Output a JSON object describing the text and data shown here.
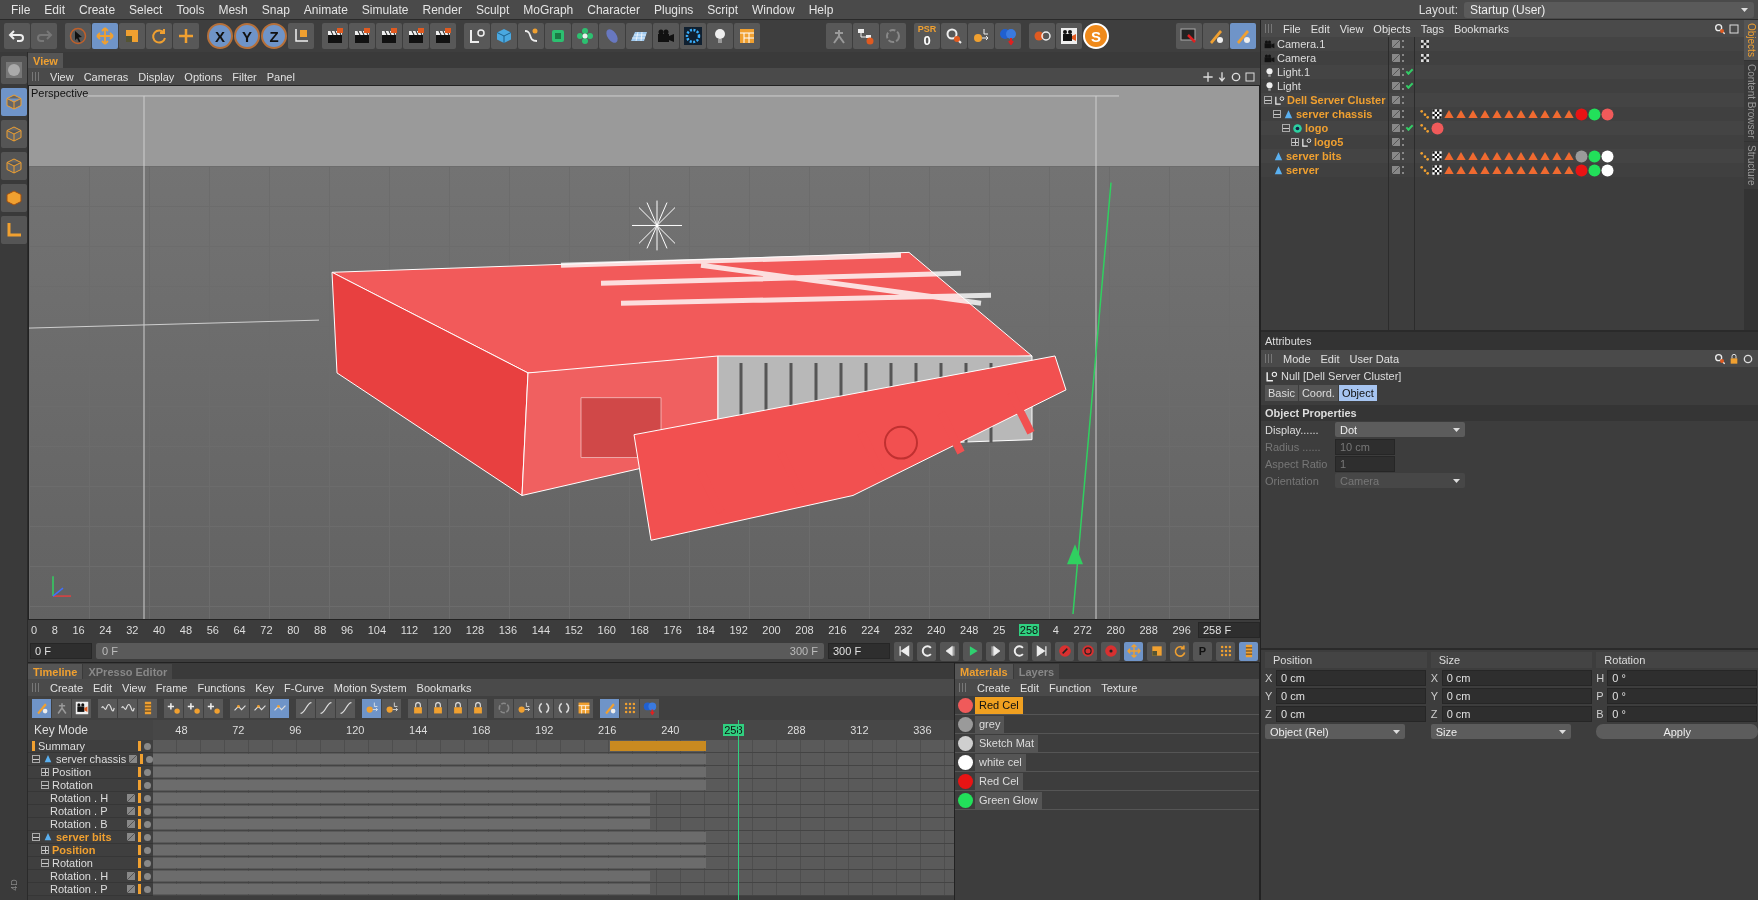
{
  "menu_bar": {
    "items": [
      "File",
      "Edit",
      "Create",
      "Select",
      "Tools",
      "Mesh",
      "Snap",
      "Animate",
      "Simulate",
      "Render",
      "Sculpt",
      "MoGraph",
      "Character",
      "Plugins",
      "Script",
      "Window",
      "Help"
    ],
    "layout_label": "Layout:",
    "layout_value": "Startup (User)"
  },
  "toolbar": {
    "left": [
      [
        {
          "kind": "undo",
          "selected": false
        },
        {
          "kind": "redo",
          "selected": false
        }
      ],
      [
        {
          "kind": "cursor",
          "selected": false
        },
        {
          "kind": "move",
          "selected": true
        },
        {
          "kind": "scale",
          "selected": false
        },
        {
          "kind": "rotate",
          "selected": false
        },
        {
          "kind": "plus",
          "selected": false
        }
      ],
      [
        {
          "kind": "axis",
          "label": "X",
          "selected": true
        },
        {
          "kind": "axis",
          "label": "Y",
          "selected": true
        },
        {
          "kind": "axis",
          "label": "Z",
          "selected": true
        },
        {
          "kind": "coords",
          "selected": false
        }
      ],
      [
        {
          "kind": "clapper",
          "selected": false
        },
        {
          "kind": "clapper",
          "selected": false
        },
        {
          "kind": "clapper",
          "selected": false
        },
        {
          "kind": "clapper",
          "selected": false
        },
        {
          "kind": "clapper",
          "selected": false
        }
      ],
      [
        {
          "kind": "null",
          "selected": false
        },
        {
          "kind": "cube",
          "selected": false
        },
        {
          "kind": "pen",
          "selected": false
        },
        {
          "kind": "nurbs",
          "selected": false
        },
        {
          "kind": "cloner",
          "selected": false
        },
        {
          "kind": "deformer",
          "selected": false
        },
        {
          "kind": "floor",
          "selected": false
        },
        {
          "kind": "camera",
          "selected": false
        },
        {
          "kind": "sky",
          "selected": false
        },
        {
          "kind": "bulb",
          "selected": false
        },
        {
          "kind": "picture",
          "selected": false
        }
      ]
    ],
    "middle": [
      [
        {
          "kind": "figure",
          "selected": false
        },
        {
          "kind": "hierarchy",
          "selected": false
        },
        {
          "kind": "recycle",
          "selected": false
        }
      ],
      [
        {
          "kind": "psr",
          "label": "PSR",
          "sub": "0",
          "selected": false
        },
        {
          "kind": "magnifier",
          "selected": false
        },
        {
          "kind": "keylink",
          "selected": false
        },
        {
          "kind": "spheres",
          "selected": false
        }
      ],
      [
        {
          "kind": "record",
          "selected": false
        },
        {
          "kind": "film",
          "selected": false
        },
        {
          "kind": "coin",
          "label": "S",
          "selected": false
        }
      ]
    ],
    "right": [
      [
        {
          "kind": "monitor",
          "selected": false
        },
        {
          "kind": "brush",
          "selected": false
        },
        {
          "kind": "brush",
          "selected": true
        }
      ]
    ]
  },
  "left_tools": {
    "items": [
      {
        "kind": "sphere",
        "selected": false
      },
      {
        "kind": "cubeframe",
        "selected": true
      },
      {
        "kind": "cubeframe",
        "selected": false
      },
      {
        "kind": "cubeframe",
        "selected": false
      },
      {
        "kind": "cubeorange",
        "selected": false
      },
      {
        "kind": "laxis",
        "selected": false
      }
    ],
    "corner_label": "4D"
  },
  "viewport": {
    "tab": "View",
    "menu": [
      "View",
      "Cameras",
      "Display",
      "Options",
      "Filter",
      "Panel"
    ],
    "camera": "Perspective"
  },
  "frame_ruler": {
    "ticks": [
      {
        "label": "0",
        "selected": false
      },
      {
        "label": "8",
        "selected": false
      },
      {
        "label": "16",
        "selected": false
      },
      {
        "label": "24",
        "selected": false
      },
      {
        "label": "32",
        "selected": false
      },
      {
        "label": "40",
        "selected": false
      },
      {
        "label": "48",
        "selected": false
      },
      {
        "label": "56",
        "selected": false
      },
      {
        "label": "64",
        "selected": false
      },
      {
        "label": "72",
        "selected": false
      },
      {
        "label": "80",
        "selected": false
      },
      {
        "label": "88",
        "selected": false
      },
      {
        "label": "96",
        "selected": false
      },
      {
        "label": "104",
        "selected": false
      },
      {
        "label": "112",
        "selected": false
      },
      {
        "label": "120",
        "selected": false
      },
      {
        "label": "128",
        "selected": false
      },
      {
        "label": "136",
        "selected": false
      },
      {
        "label": "144",
        "selected": false
      },
      {
        "label": "152",
        "selected": false
      },
      {
        "label": "160",
        "selected": false
      },
      {
        "label": "168",
        "selected": false
      },
      {
        "label": "176",
        "selected": false
      },
      {
        "label": "184",
        "selected": false
      },
      {
        "label": "192",
        "selected": false
      },
      {
        "label": "200",
        "selected": false
      },
      {
        "label": "208",
        "selected": false
      },
      {
        "label": "216",
        "selected": false
      },
      {
        "label": "224",
        "selected": false
      },
      {
        "label": "232",
        "selected": false
      },
      {
        "label": "240",
        "selected": false
      },
      {
        "label": "248",
        "selected": false
      },
      {
        "label": "25",
        "selected": false
      },
      {
        "label": "258",
        "selected": true
      },
      {
        "label": "4",
        "selected": false
      },
      {
        "label": "272",
        "selected": false
      },
      {
        "label": "280",
        "selected": false
      },
      {
        "label": "288",
        "selected": false
      },
      {
        "label": "296",
        "selected": false
      }
    ],
    "current_field": "258 F"
  },
  "frame_controls": {
    "start_field": "0 F",
    "slider_start": "0 F",
    "slider_end": "300 F",
    "level": 1,
    "end_field": "300 F",
    "transport": [
      {
        "kind": "first",
        "selected": false
      },
      {
        "kind": "loop",
        "selected": false
      },
      {
        "kind": "prevkey",
        "selected": false
      },
      {
        "kind": "play",
        "selected": false
      },
      {
        "kind": "nextkey",
        "selected": false
      },
      {
        "kind": "loop",
        "selected": false
      },
      {
        "kind": "last",
        "selected": false
      },
      {
        "kind": "recred",
        "selected": false
      },
      {
        "kind": "autokey",
        "selected": false
      },
      {
        "kind": "keyhelp",
        "selected": false
      },
      {
        "kind": "move",
        "selected": true
      },
      {
        "kind": "scale",
        "selected": false
      },
      {
        "kind": "rotate",
        "selected": false
      },
      {
        "kind": "param",
        "label": "P",
        "selected": false
      },
      {
        "kind": "dots",
        "selected": false
      },
      {
        "kind": "tlbars",
        "selected": true
      }
    ]
  },
  "timeline": {
    "tabs": [
      {
        "label": "Timeline",
        "selected": true
      },
      {
        "label": "XPresso Editor",
        "selected": false
      }
    ],
    "menu": [
      "Create",
      "Edit",
      "View",
      "Frame",
      "Functions",
      "Key",
      "F-Curve",
      "Motion System",
      "Bookmarks"
    ],
    "tools": [
      [
        {
          "kind": "brush",
          "selected": true
        },
        {
          "kind": "figure",
          "selected": false
        },
        {
          "kind": "film",
          "selected": false
        }
      ],
      [
        {
          "kind": "wave",
          "selected": false
        },
        {
          "kind": "wave",
          "selected": false
        },
        {
          "kind": "tlbars",
          "selected": false
        }
      ],
      [
        {
          "kind": "keyadd",
          "selected": false
        },
        {
          "kind": "keyadd",
          "selected": false
        },
        {
          "kind": "keyadd",
          "selected": false
        }
      ],
      [
        {
          "kind": "linear",
          "selected": false
        },
        {
          "kind": "linear",
          "selected": false
        },
        {
          "kind": "linear",
          "selected": true
        }
      ],
      [
        {
          "kind": "curve",
          "selected": false
        },
        {
          "kind": "curve",
          "selected": false
        },
        {
          "kind": "curve",
          "selected": false
        }
      ],
      [
        {
          "kind": "keylink",
          "selected": true
        },
        {
          "kind": "keylink",
          "selected": false
        }
      ],
      [
        {
          "kind": "lock",
          "selected": false
        },
        {
          "kind": "lock",
          "selected": false
        },
        {
          "kind": "lock",
          "selected": false
        },
        {
          "kind": "lock",
          "selected": false
        }
      ],
      [
        {
          "kind": "recycle",
          "selected": false
        },
        {
          "kind": "keylink",
          "selected": false
        },
        {
          "kind": "bracket",
          "selected": false
        },
        {
          "kind": "bracket",
          "selected": false
        },
        {
          "kind": "picture",
          "selected": false
        }
      ],
      [
        {
          "kind": "brush",
          "selected": true
        },
        {
          "kind": "dots",
          "selected": false
        },
        {
          "kind": "spheres",
          "selected": false
        }
      ]
    ],
    "mode_label": "Key Mode",
    "ticks": [
      {
        "label": "48",
        "selected": false
      },
      {
        "label": "72",
        "selected": false
      },
      {
        "label": "96",
        "selected": false
      },
      {
        "label": "120",
        "selected": false
      },
      {
        "label": "144",
        "selected": false
      },
      {
        "label": "168",
        "selected": false
      },
      {
        "label": "192",
        "selected": false
      },
      {
        "label": "216",
        "selected": false
      },
      {
        "label": "240",
        "selected": false
      },
      {
        "label": "258",
        "selected": true
      },
      {
        "label": "288",
        "selected": false
      },
      {
        "label": "312",
        "selected": false
      },
      {
        "label": "336",
        "selected": false
      }
    ],
    "tracks": [
      {
        "label": "Summary",
        "kind": "summary",
        "selected": false
      },
      {
        "label": "server chassis",
        "kind": "object",
        "selected": false,
        "expanded": true,
        "children": [
          {
            "label": "Position",
            "kind": "folder",
            "selected": false,
            "expanded": false
          },
          {
            "label": "Rotation",
            "kind": "folder",
            "selected": false,
            "expanded": true,
            "children": [
              {
                "label": "Rotation . H",
                "kind": "param",
                "selected": false
              },
              {
                "label": "Rotation . P",
                "kind": "param",
                "selected": false
              },
              {
                "label": "Rotation . B",
                "kind": "param",
                "selected": false
              }
            ]
          }
        ]
      },
      {
        "label": "server bits",
        "kind": "object",
        "selected": true,
        "expanded": true,
        "children": [
          {
            "label": "Position",
            "kind": "folder",
            "selected": true,
            "expanded": false
          },
          {
            "label": "Rotation",
            "kind": "folder",
            "selected": false,
            "expanded": true,
            "children": [
              {
                "label": "Rotation . H",
                "kind": "param",
                "selected": false
              },
              {
                "label": "Rotation . P",
                "kind": "param",
                "selected": false
              }
            ]
          }
        ]
      }
    ]
  },
  "materials": {
    "tabs": [
      {
        "label": "Materials",
        "selected": true
      },
      {
        "label": "Layers",
        "selected": false
      }
    ],
    "menu": [
      "Create",
      "Edit",
      "Function",
      "Texture"
    ],
    "items": [
      {
        "name": "Red Cel",
        "color": "#f05a5a",
        "selected": true
      },
      {
        "name": "grey",
        "color": "#9a9a9a",
        "selected": false
      },
      {
        "name": "Sketch Mat",
        "color": "#cfcfcf",
        "selected": false
      },
      {
        "name": "white cel",
        "color": "#ffffff",
        "selected": false
      },
      {
        "name": "Red Cel",
        "color": "#e81414",
        "selected": false
      },
      {
        "name": "Green Glow",
        "color": "#22e05a",
        "selected": false
      }
    ]
  },
  "object_manager": {
    "menu": [
      "File",
      "Edit",
      "View",
      "Objects",
      "Tags",
      "Bookmarks"
    ],
    "side_tabs": [
      {
        "label": "Objects",
        "selected": true
      },
      {
        "label": "Content Browser",
        "selected": false
      },
      {
        "label": "Structure",
        "selected": false
      }
    ],
    "objects": [
      {
        "name": "Camera.1",
        "kind": "camera",
        "selected": false,
        "checked": false,
        "tags": [
          {
            "kind": "target"
          }
        ]
      },
      {
        "name": "Camera",
        "kind": "camera",
        "selected": false,
        "checked": false,
        "tags": [
          {
            "kind": "target"
          }
        ]
      },
      {
        "name": "Light.1",
        "kind": "light",
        "selected": false,
        "checked": true
      },
      {
        "name": "Light",
        "kind": "light",
        "selected": false,
        "checked": true
      },
      {
        "name": "Dell Server Cluster",
        "kind": "null",
        "selected": true,
        "checked": false,
        "expanded": true,
        "children": [
          {
            "name": "server chassis",
            "kind": "polygon",
            "selected": true,
            "checked": false,
            "expanded": true,
            "tags": [
              {
                "kind": "dots"
              },
              {
                "kind": "checker"
              },
              {
                "kind": "sketch"
              },
              {
                "kind": "sketch"
              },
              {
                "kind": "sketch"
              },
              {
                "kind": "sketch"
              },
              {
                "kind": "sketch"
              },
              {
                "kind": "sketch"
              },
              {
                "kind": "sketch"
              },
              {
                "kind": "sketch"
              },
              {
                "kind": "sketch"
              },
              {
                "kind": "sketch"
              },
              {
                "kind": "sketch"
              },
              {
                "kind": "material",
                "color": "#e81414"
              },
              {
                "kind": "material",
                "color": "#22e05a"
              },
              {
                "kind": "material",
                "color": "#f05a5a"
              }
            ],
            "children": [
              {
                "name": "logo",
                "kind": "logo",
                "selected": true,
                "checked": true,
                "expanded": true,
                "tags": [
                  {
                    "kind": "dots"
                  },
                  {
                    "kind": "material",
                    "color": "#f05a5a"
                  }
                ],
                "children": [
                  {
                    "name": "logo5",
                    "kind": "null",
                    "selected": true,
                    "checked": false,
                    "expanded": false
                  }
                ]
              }
            ]
          },
          {
            "name": "server bits",
            "kind": "polygon",
            "selected": true,
            "checked": false,
            "tags": [
              {
                "kind": "dots"
              },
              {
                "kind": "checker"
              },
              {
                "kind": "sketch"
              },
              {
                "kind": "sketch"
              },
              {
                "kind": "sketch"
              },
              {
                "kind": "sketch"
              },
              {
                "kind": "sketch"
              },
              {
                "kind": "sketch"
              },
              {
                "kind": "sketch"
              },
              {
                "kind": "sketch"
              },
              {
                "kind": "sketch"
              },
              {
                "kind": "sketch"
              },
              {
                "kind": "sketch"
              },
              {
                "kind": "material",
                "color": "#9a9a9a"
              },
              {
                "kind": "material",
                "color": "#22e05a"
              },
              {
                "kind": "material",
                "color": "#ffffff"
              }
            ]
          },
          {
            "name": "server",
            "kind": "polygon",
            "selected": true,
            "checked": false,
            "tags": [
              {
                "kind": "dots"
              },
              {
                "kind": "checker"
              },
              {
                "kind": "sketch"
              },
              {
                "kind": "sketch"
              },
              {
                "kind": "sketch"
              },
              {
                "kind": "sketch"
              },
              {
                "kind": "sketch"
              },
              {
                "kind": "sketch"
              },
              {
                "kind": "sketch"
              },
              {
                "kind": "sketch"
              },
              {
                "kind": "sketch"
              },
              {
                "kind": "sketch"
              },
              {
                "kind": "sketch"
              },
              {
                "kind": "material",
                "color": "#e81414"
              },
              {
                "kind": "material",
                "color": "#22e05a"
              },
              {
                "kind": "material",
                "color": "#ffffff"
              }
            ]
          }
        ]
      }
    ]
  },
  "attributes": {
    "title": "Attributes",
    "menu": [
      "Mode",
      "Edit",
      "User Data"
    ],
    "object_title": "Null [Dell Server Cluster]",
    "tabs": [
      {
        "label": "Basic",
        "selected": false
      },
      {
        "label": "Coord.",
        "selected": false
      },
      {
        "label": "Object",
        "selected": true
      }
    ],
    "section": "Object Properties",
    "fields": [
      {
        "label": "Display......",
        "value": "Dot",
        "kind": "dropdown",
        "disabled": false
      },
      {
        "label": "Radius ......",
        "value": "10 cm",
        "kind": "number",
        "disabled": true
      },
      {
        "label": "Aspect Ratio",
        "value": "1",
        "kind": "number",
        "disabled": true
      },
      {
        "label": "Orientation",
        "value": "Camera",
        "kind": "dropdown",
        "disabled": true
      }
    ]
  },
  "coordinates": {
    "columns": [
      {
        "title": "Position",
        "rows": [
          {
            "axis": "X",
            "value": "0 cm"
          },
          {
            "axis": "Y",
            "value": "0 cm"
          },
          {
            "axis": "Z",
            "value": "0 cm"
          }
        ],
        "dropdown": "Object (Rel)"
      },
      {
        "title": "Size",
        "rows": [
          {
            "axis": "X",
            "value": "0 cm"
          },
          {
            "axis": "Y",
            "value": "0 cm"
          },
          {
            "axis": "Z",
            "value": "0 cm"
          }
        ],
        "dropdown": "Size"
      },
      {
        "title": "Rotation",
        "rows": [
          {
            "axis": "H",
            "value": "0 °"
          },
          {
            "axis": "P",
            "value": "0 °"
          },
          {
            "axis": "B",
            "value": "0 °"
          }
        ],
        "button": "Apply"
      }
    ]
  }
}
